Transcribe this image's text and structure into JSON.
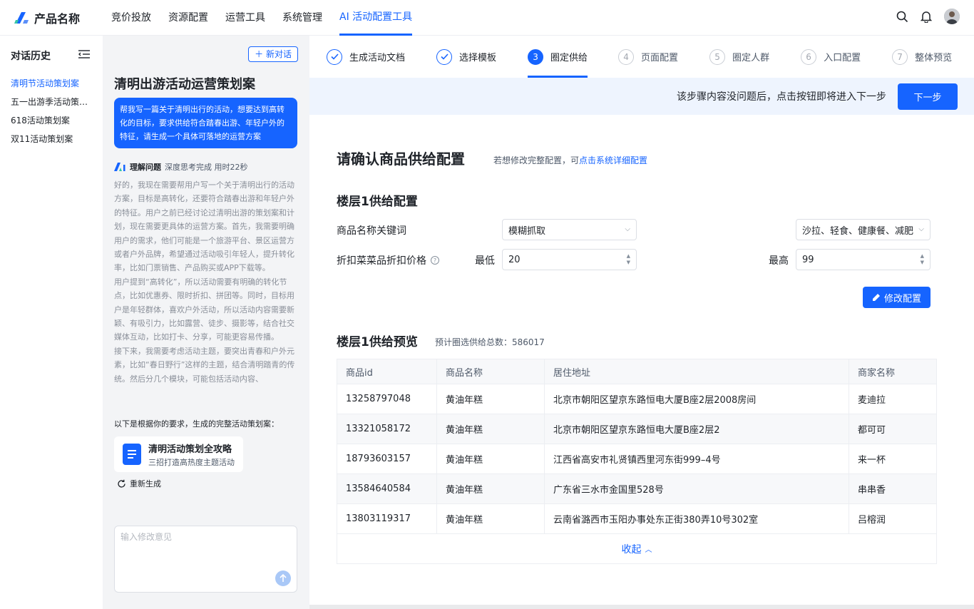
{
  "topbar": {
    "brand": "产品名称",
    "nav": [
      "竞价投放",
      "资源配置",
      "运营工具",
      "系统管理",
      "AI 活动配置工具"
    ],
    "active_nav_index": 4,
    "icons": [
      "search-icon",
      "bell-icon",
      "avatar"
    ]
  },
  "history": {
    "title": "对话历史",
    "items": [
      "清明节活动策划案",
      "五一出游季活动策划案",
      "618活动策划案",
      "双11活动策划案"
    ],
    "active_index": 0
  },
  "chat": {
    "new_chat": "新对话",
    "title": "清明出游活动运营策划案",
    "user_message": "帮我写一篇关于清明出行的活动，想要达到高转化的目标，要求供给符合踏春出游、年轻户外的特征，请生成一个具体可落地的运营方案",
    "think_label": "理解问题",
    "think_status": "深度思考完成 用时22秒",
    "think_text": "好的，我现在需要帮用户写一个关于清明出行的活动方案，目标是高转化，还要符合踏春出游和年轻户外的特征。用户之前已经讨论过清明出游的策划案和计划，现在需要更具体的运营方案。首先，我需要明确用户的需求，他们可能是一个旅游平台、景区运营方或者户外品牌，希望通过活动吸引年轻人，提升转化率，比如门票销售、产品购买或APP下载等。\n用户提到“高转化”，所以活动需要有明确的转化节点，比如优惠券、限时折扣、拼团等。同时，目标用户是年轻群体，喜欢户外活动，所以活动内容需要新颖、有吸引力，比如露营、徒步、摄影等，结合社交媒体互动，比如打卡、分享，可能更容易传播。\n接下来，我需要考虑活动主题，要突出青春和户外元素，比如“春日野行”这样的主题，结合清明踏青的传统。然后分几个模块，可能包括活动内容、",
    "result_intro": "以下是根据你的要求，生成的完整活动策划案：",
    "doc_title": "清明活动策划全攻略",
    "doc_sub": "三招打造高热度主题活动",
    "regenerate": "重新生成",
    "input_placeholder": "输入修改意见"
  },
  "steps": [
    {
      "num": "1",
      "label": "生成活动文档",
      "state": "done"
    },
    {
      "num": "2",
      "label": "选择模板",
      "state": "done"
    },
    {
      "num": "3",
      "label": "圈定供给",
      "state": "current"
    },
    {
      "num": "4",
      "label": "页面配置",
      "state": "todo"
    },
    {
      "num": "5",
      "label": "圈定人群",
      "state": "todo"
    },
    {
      "num": "6",
      "label": "入口配置",
      "state": "todo"
    },
    {
      "num": "7",
      "label": "整体预览",
      "state": "todo"
    }
  ],
  "next_bar": {
    "hint": "该步骤内容没问题后，点击按钮即将进入下一步",
    "button": "下一步"
  },
  "supply": {
    "title": "请确认商品供给配置",
    "note_prefix": "若想修改完整配置，可",
    "note_link": "点击系统详细配置",
    "floor_title": "楼层1供给配置",
    "keyword_label": "商品名称关键词",
    "match_mode": "模糊抓取",
    "keywords": "沙拉、轻食、健康餐、减肥",
    "price_label": "折扣菜菜品折扣价格",
    "min_label": "最低",
    "min_value": "20",
    "max_label": "最高",
    "max_value": "99",
    "edit_button": "修改配置"
  },
  "preview": {
    "title": "楼层1供给预览",
    "total_note": "预计圈选供给总数：586017",
    "columns": [
      "商品id",
      "商品名称",
      "居住地址",
      "商家名称"
    ],
    "rows": [
      [
        "13258797048",
        "黄油年糕",
        "北京市朝阳区望京东路恒电大厦B座2层2008房间",
        "麦迪拉"
      ],
      [
        "13321058172",
        "黄油年糕",
        "北京市朝阳区望京东路恒电大厦B座2层2",
        "都可可"
      ],
      [
        "18793603157",
        "黄油年糕",
        "江西省高安市礼贤镇西里河东街999–4号",
        "来一杯"
      ],
      [
        "13584640584",
        "黄油年糕",
        "广东省三水市金国里528号",
        "串串香"
      ],
      [
        "13803119317",
        "黄油年糕",
        "云南省潞西市玉阳办事处东正街380弄10号302室",
        "吕榕润"
      ]
    ],
    "collapse": "收起"
  },
  "colors": {
    "accent": "#1664ff",
    "chat_bg": "#f3f4f6",
    "banner_bg": "#eef4fe"
  }
}
